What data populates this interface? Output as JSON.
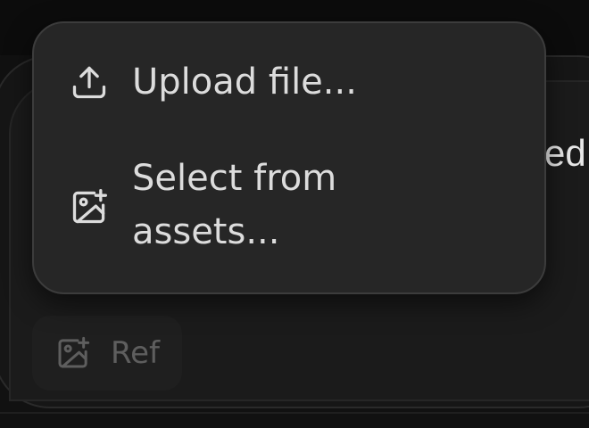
{
  "menu": {
    "items": [
      {
        "label": "Upload file...",
        "icon": "upload-icon"
      },
      {
        "label": "Select from assets...",
        "icon": "image-plus-icon"
      }
    ]
  },
  "toolbar": {
    "ref_label": "Ref",
    "ref_icon": "image-plus-icon"
  },
  "background": {
    "partial_text": "red"
  },
  "colors": {
    "menu_bg": "#262626",
    "menu_border": "#3c3c3c",
    "menu_text": "#dcdcdc",
    "ref_bg": "#1f1f1f",
    "ref_text": "#5e5e5e"
  }
}
